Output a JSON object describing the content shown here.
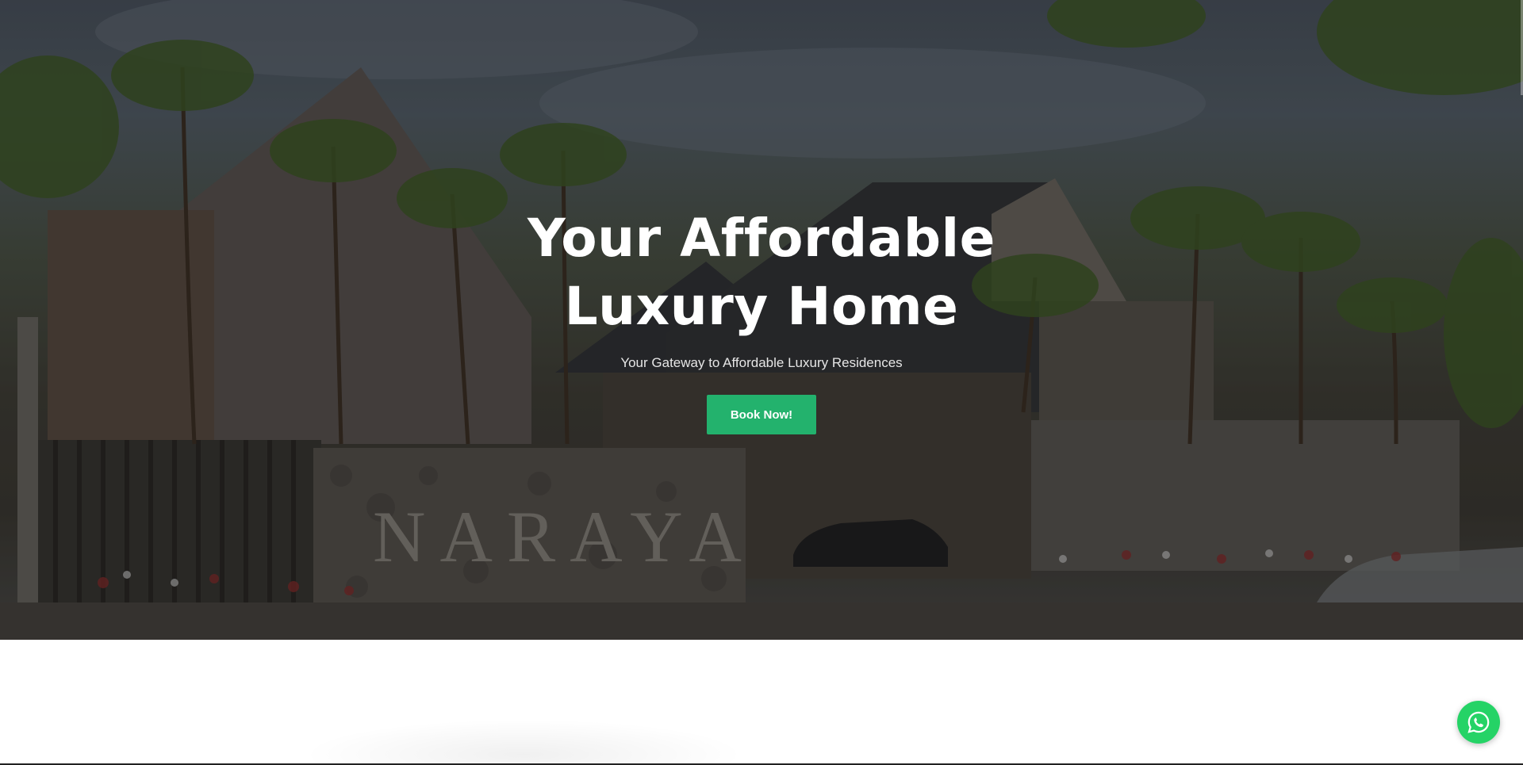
{
  "hero": {
    "title_line1": "Your Affordable",
    "title_line2": "Luxury Home",
    "subtitle": "Your Gateway to Affordable Luxury Residences",
    "cta_label": "Book Now!",
    "background_sign_text": "NARAYA"
  },
  "floating": {
    "whatsapp_icon": "whatsapp-icon"
  },
  "colors": {
    "accent": "#23b26d",
    "whatsapp": "#25d366",
    "text_light": "#ffffff"
  }
}
